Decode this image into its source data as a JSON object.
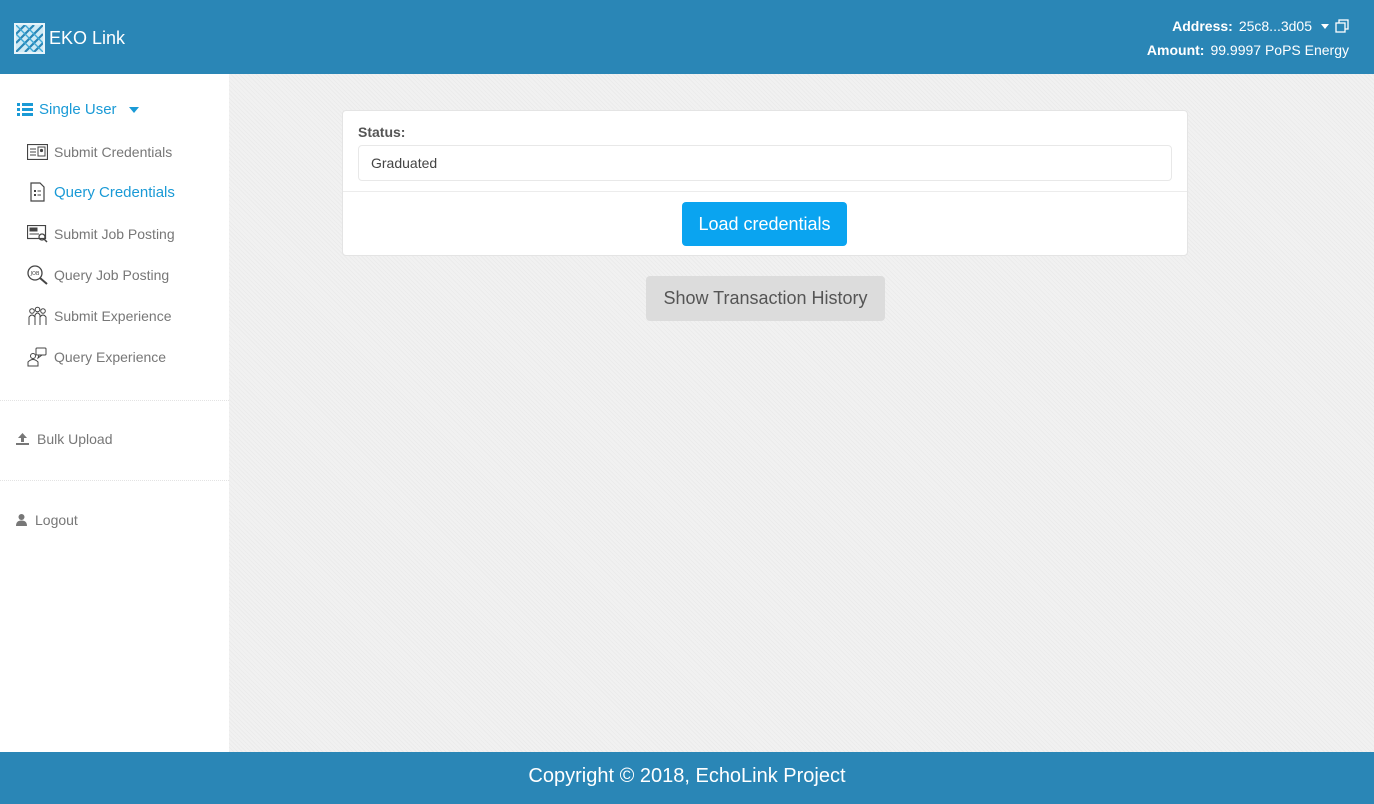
{
  "header": {
    "app_name": "EKO Link",
    "address_label": "Address:",
    "address_value": "25c8...3d05",
    "amount_label": "Amount:",
    "amount_value": "99.9997 PoPS Energy",
    "brand_color": "#2a86b6"
  },
  "sidebar": {
    "section_title": "Single User",
    "items": [
      {
        "label": "Submit Credentials",
        "icon": "id-card-icon",
        "active": false
      },
      {
        "label": "Query Credentials",
        "icon": "document-icon",
        "active": true
      },
      {
        "label": "Submit Job Posting",
        "icon": "job-board-icon",
        "active": false
      },
      {
        "label": "Query Job Posting",
        "icon": "job-search-icon",
        "active": false
      },
      {
        "label": "Submit Experience",
        "icon": "people-icon",
        "active": false
      },
      {
        "label": "Query Experience",
        "icon": "speech-person-icon",
        "active": false
      }
    ],
    "bulk_upload": "Bulk Upload",
    "logout": "Logout",
    "accent_color": "#1a9ad6"
  },
  "main": {
    "status_label": "Status:",
    "status_value": "Graduated",
    "load_button": "Load credentials",
    "history_button": "Show Transaction History"
  },
  "footer": {
    "copyright": "Copyright © 2018, EchoLink Project"
  }
}
